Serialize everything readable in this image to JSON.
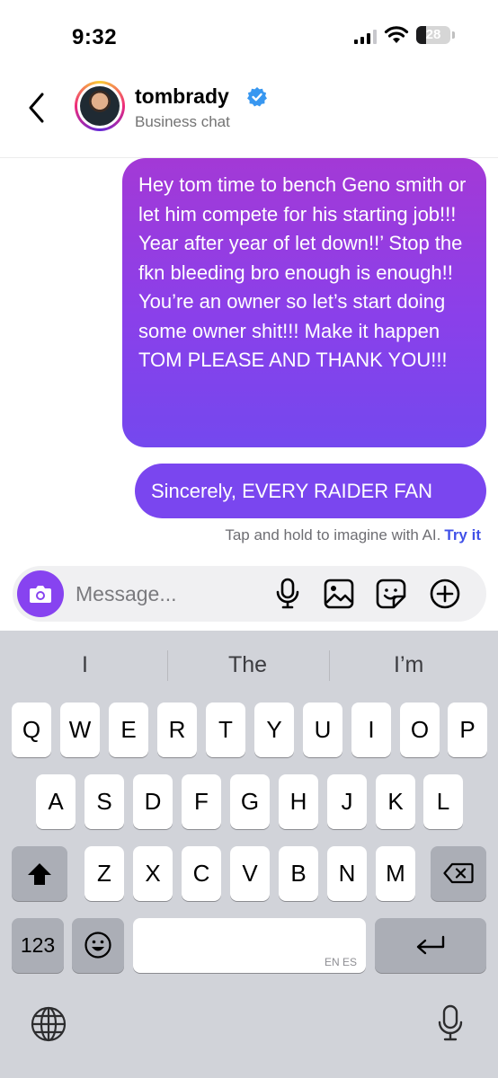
{
  "status_bar": {
    "time": "9:32",
    "battery": "28"
  },
  "header": {
    "username": "tombrady",
    "subtitle": "Business chat"
  },
  "messages": [
    {
      "sender": "me",
      "text": "Hey tom time to bench Geno smith or let him compete for his starting job!!! Year after year of let down!!’ Stop the fkn bleeding bro enough is enough!! You’re an owner so let’s start doing some owner shit!!! Make it happen TOM PLEASE AND THANK YOU!!!"
    },
    {
      "sender": "me",
      "text": "Sincerely, EVERY RAIDER FAN"
    }
  ],
  "hint": {
    "text": "Tap and hold to imagine with AI.",
    "link": "Try it"
  },
  "composer": {
    "placeholder": "Message..."
  },
  "keyboard": {
    "suggestions": [
      "I",
      "The",
      "I’m"
    ],
    "row1": [
      "Q",
      "W",
      "E",
      "R",
      "T",
      "Y",
      "U",
      "I",
      "O",
      "P"
    ],
    "row2": [
      "A",
      "S",
      "D",
      "F",
      "G",
      "H",
      "J",
      "K",
      "L"
    ],
    "row3": [
      "Z",
      "X",
      "C",
      "V",
      "B",
      "N",
      "M"
    ],
    "numbers_key": "123",
    "space_lang": "EN ES"
  },
  "colors": {
    "accent": "#8743f0",
    "link": "#4151e8",
    "verified": "#3897f0"
  },
  "icons": [
    "back-chevron-icon",
    "verified-badge-icon",
    "camera-icon",
    "microphone-icon",
    "gallery-icon",
    "sticker-icon",
    "add-icon",
    "shift-icon",
    "delete-icon",
    "emoji-icon",
    "return-icon",
    "globe-icon",
    "dictation-icon"
  ]
}
